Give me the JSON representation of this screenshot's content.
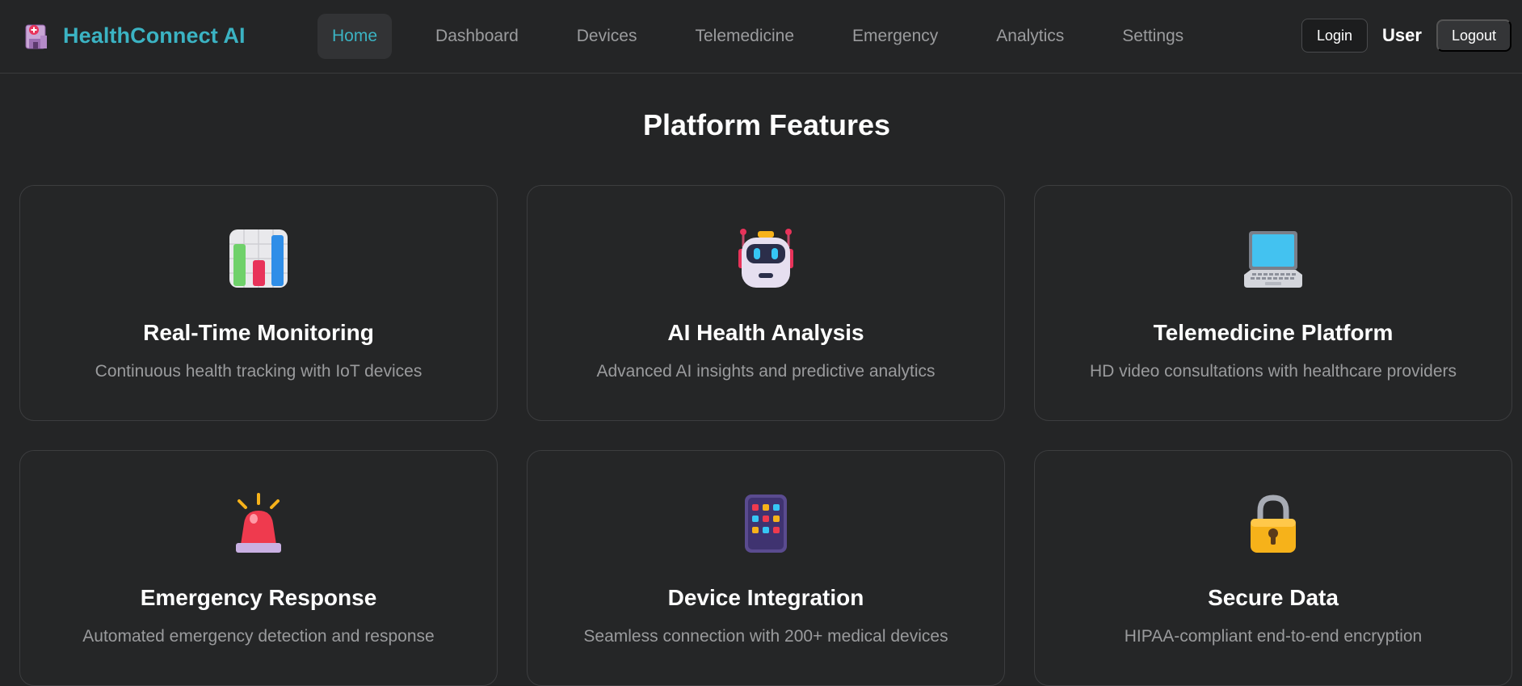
{
  "brand": {
    "name": "HealthConnect AI",
    "icon": "hospital-icon",
    "color": "#3bb3c3"
  },
  "nav": {
    "items": [
      {
        "label": "Home",
        "active": true
      },
      {
        "label": "Dashboard",
        "active": false
      },
      {
        "label": "Devices",
        "active": false
      },
      {
        "label": "Telemedicine",
        "active": false
      },
      {
        "label": "Emergency",
        "active": false
      },
      {
        "label": "Analytics",
        "active": false
      },
      {
        "label": "Settings",
        "active": false
      }
    ]
  },
  "auth": {
    "login_label": "Login",
    "user_label": "User",
    "logout_label": "Logout"
  },
  "main": {
    "title": "Platform Features",
    "features": [
      {
        "icon": "bar-chart-icon",
        "title": "Real-Time Monitoring",
        "description": "Continuous health tracking with IoT devices"
      },
      {
        "icon": "robot-icon",
        "title": "AI Health Analysis",
        "description": "Advanced AI insights and predictive analytics"
      },
      {
        "icon": "laptop-icon",
        "title": "Telemedicine Platform",
        "description": "HD video consultations with healthcare providers"
      },
      {
        "icon": "siren-icon",
        "title": "Emergency Response",
        "description": "Automated emergency detection and response"
      },
      {
        "icon": "mobile-device-icon",
        "title": "Device Integration",
        "description": "Seamless connection with 200+ medical devices"
      },
      {
        "icon": "lock-icon",
        "title": "Secure Data",
        "description": "HIPAA-compliant end-to-end encryption"
      }
    ]
  },
  "colors": {
    "background": "#242526",
    "accent": "#3bb3c3",
    "muted_text": "#9a9b9d"
  }
}
